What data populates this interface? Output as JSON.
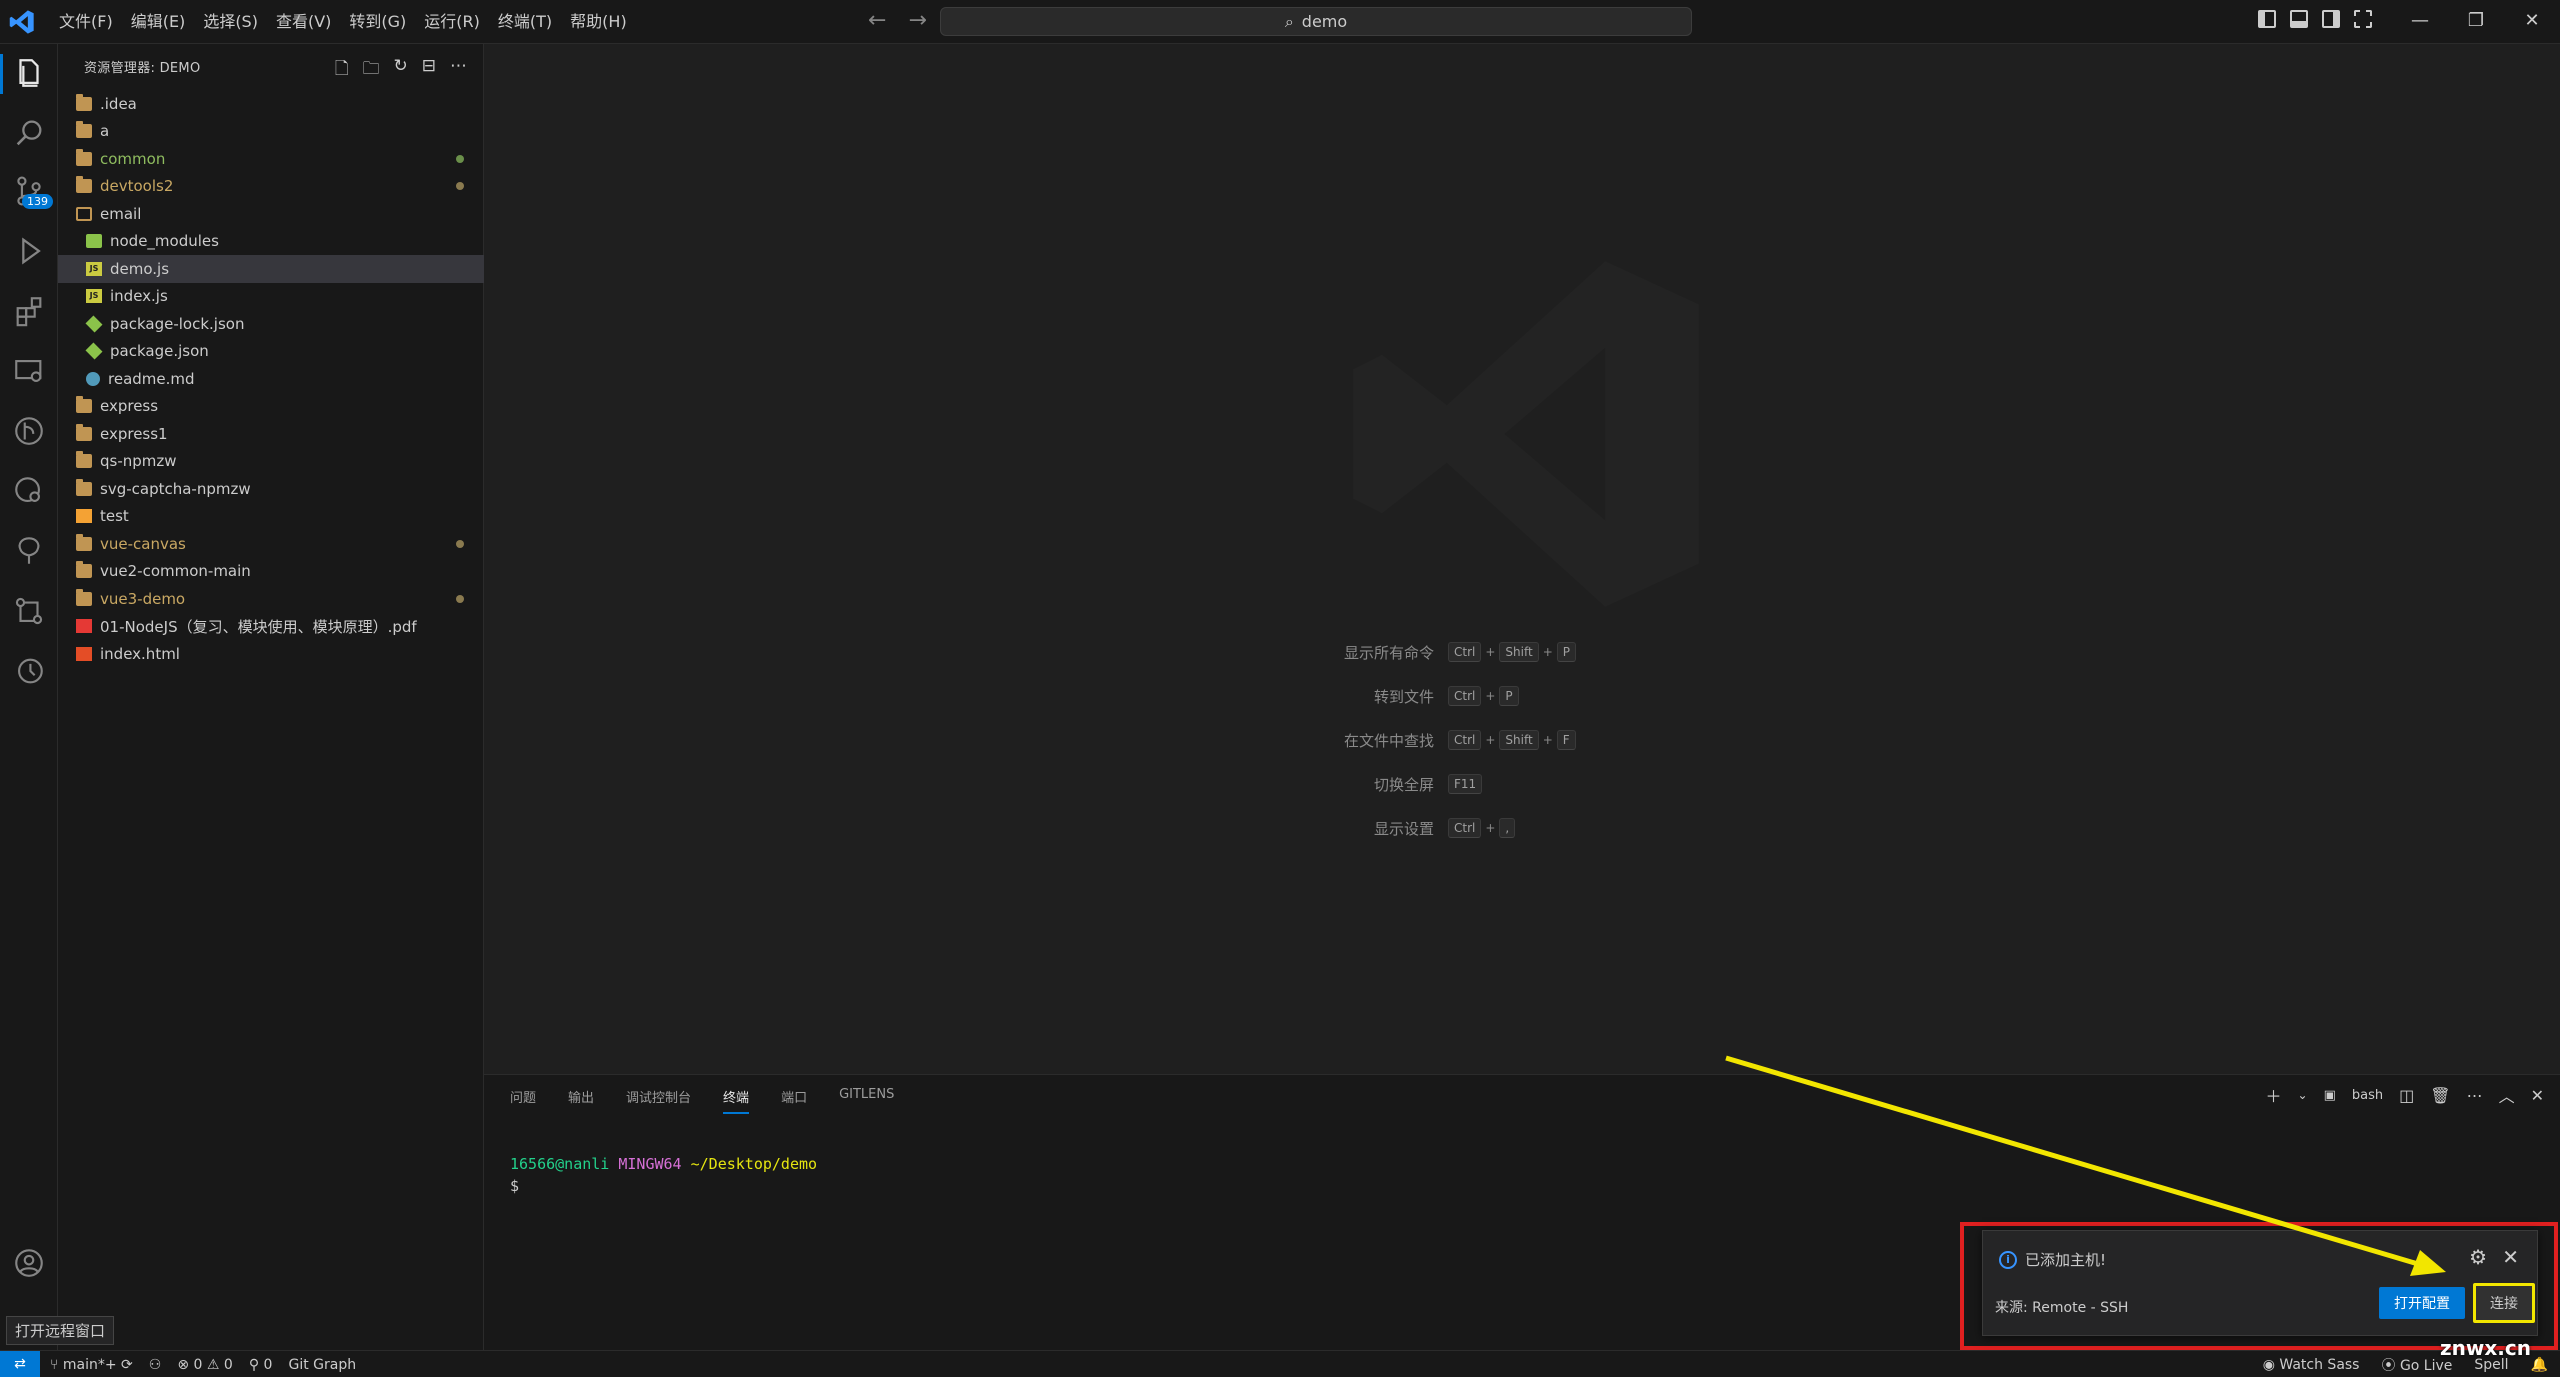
{
  "titlebar": {
    "menu": [
      "文件(F)",
      "编辑(E)",
      "选择(S)",
      "查看(V)",
      "转到(G)",
      "运行(R)",
      "终端(T)",
      "帮助(H)"
    ],
    "search_text": "demo"
  },
  "activity": {
    "scm_badge": "139"
  },
  "sidebar": {
    "title": "资源管理器: DEMO",
    "items": [
      {
        "label": ".idea",
        "icon": "folder",
        "indent": 0
      },
      {
        "label": "a",
        "icon": "folder",
        "indent": 0
      },
      {
        "label": "common",
        "icon": "folder",
        "indent": 0,
        "color": "green",
        "dot": "green"
      },
      {
        "label": "devtools2",
        "icon": "folder",
        "indent": 0,
        "color": "yellow",
        "dot": "yellow"
      },
      {
        "label": "email",
        "icon": "folder-open",
        "indent": 0
      },
      {
        "label": "node_modules",
        "icon": "node",
        "indent": 1
      },
      {
        "label": "demo.js",
        "icon": "js",
        "indent": 1,
        "selected": true
      },
      {
        "label": "index.js",
        "icon": "js",
        "indent": 1
      },
      {
        "label": "package-lock.json",
        "icon": "pkg",
        "indent": 1
      },
      {
        "label": "package.json",
        "icon": "pkg",
        "indent": 1
      },
      {
        "label": "readme.md",
        "icon": "info",
        "indent": 1
      },
      {
        "label": "express",
        "icon": "folder",
        "indent": 0
      },
      {
        "label": "express1",
        "icon": "folder",
        "indent": 0
      },
      {
        "label": "qs-npmzw",
        "icon": "folder",
        "indent": 0
      },
      {
        "label": "svg-captcha-npmzw",
        "icon": "folder",
        "indent": 0
      },
      {
        "label": "test",
        "icon": "test",
        "indent": 0
      },
      {
        "label": "vue-canvas",
        "icon": "folder",
        "indent": 0,
        "color": "yellow",
        "dot": "yellow"
      },
      {
        "label": "vue2-common-main",
        "icon": "folder",
        "indent": 0
      },
      {
        "label": "vue3-demo",
        "icon": "folder",
        "indent": 0,
        "color": "yellow",
        "dot": "yellow"
      },
      {
        "label": "01-NodeJS（复习、模块使用、模块原理）.pdf",
        "icon": "pdf",
        "indent": 0
      },
      {
        "label": "index.html",
        "icon": "html5",
        "indent": 0
      }
    ]
  },
  "editor": {
    "shortcuts": [
      {
        "label": "显示所有命令",
        "keys": [
          "Ctrl",
          "+",
          "Shift",
          "+",
          "P"
        ]
      },
      {
        "label": "转到文件",
        "keys": [
          "Ctrl",
          "+",
          "P"
        ]
      },
      {
        "label": "在文件中查找",
        "keys": [
          "Ctrl",
          "+",
          "Shift",
          "+",
          "F"
        ]
      },
      {
        "label": "切换全屏",
        "keys": [
          "F11"
        ]
      },
      {
        "label": "显示设置",
        "keys": [
          "Ctrl",
          "+",
          ","
        ]
      }
    ]
  },
  "panel": {
    "tabs": [
      "问题",
      "输出",
      "调试控制台",
      "终端",
      "端口",
      "GITLENS"
    ],
    "active_tab": "终端",
    "shell": "bash",
    "terminal": {
      "user": "16566@nanli",
      "env": "MINGW64",
      "path": "~/Desktop/demo",
      "prompt": "$"
    }
  },
  "notification": {
    "message": "已添加主机!",
    "source": "来源: Remote - SSH",
    "primary_button": "打开配置",
    "secondary_button": "连接"
  },
  "tooltip": "打开远程窗口",
  "statusbar": {
    "branch": "main*+",
    "errors": "0",
    "warnings": "0",
    "ports": "0",
    "git_graph": "Git Graph",
    "watch_sass": "Watch Sass",
    "go_live": "Go Live",
    "spell": "Spell"
  },
  "watermark_text": "znwx.cn",
  "colors": {
    "accent": "#0078d4",
    "annotation_red": "#e02020",
    "annotation_yellow": "#f2e600"
  }
}
